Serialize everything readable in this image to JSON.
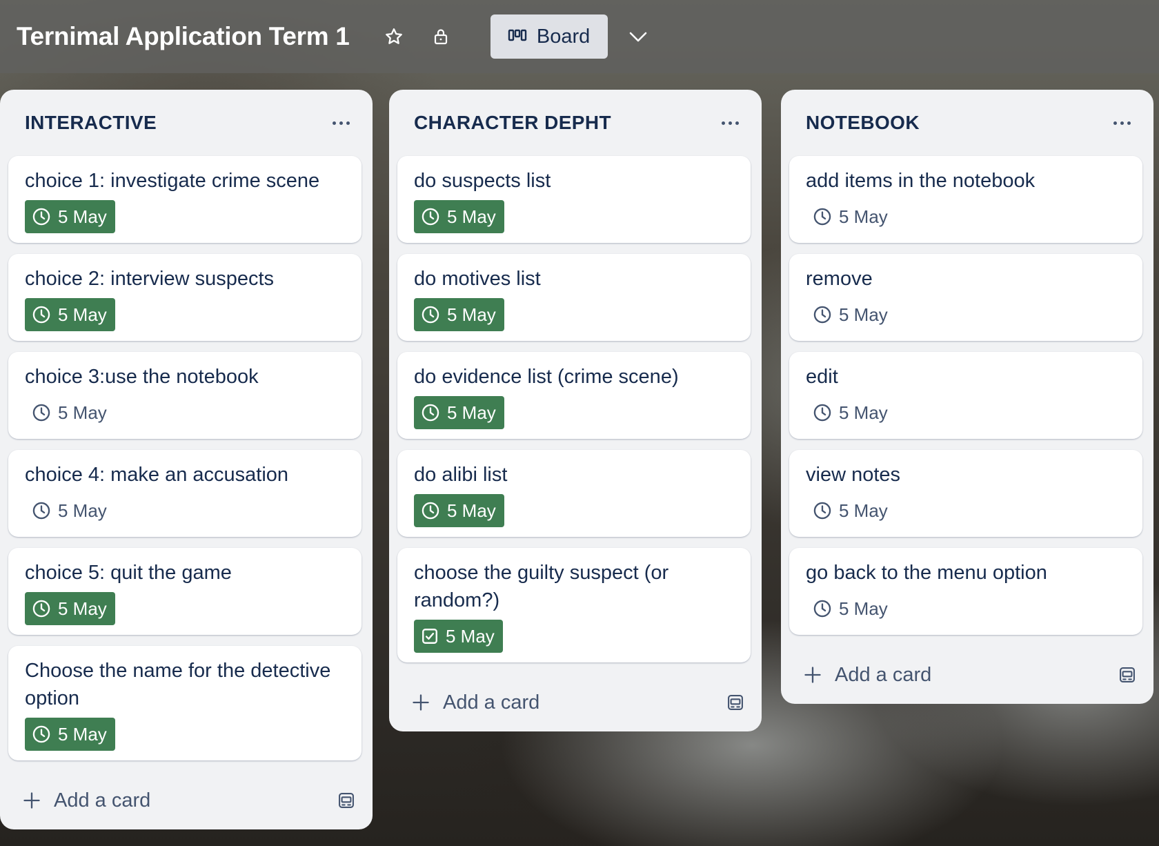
{
  "header": {
    "title": "Ternimal Application Term 1",
    "view_label": "Board",
    "icons": [
      "star-icon",
      "lock-icon",
      "board-icon",
      "chevron-down-icon"
    ]
  },
  "colors": {
    "badge_green": "#3f7e52",
    "list_bg": "#f1f2f4",
    "text": "#172b4d"
  },
  "lists": [
    {
      "title": "INTERACTIVE",
      "add_label": "Add a card",
      "cards": [
        {
          "title": "choice 1: investigate crime scene",
          "date": "5 May",
          "complete": true,
          "icon": "clock-icon"
        },
        {
          "title": "choice 2: interview suspects",
          "date": "5 May",
          "complete": true,
          "icon": "clock-icon"
        },
        {
          "title": "choice 3:use the notebook",
          "date": "5 May",
          "complete": false,
          "icon": "clock-icon"
        },
        {
          "title": "choice 4: make an accusation",
          "date": "5 May",
          "complete": false,
          "icon": "clock-icon"
        },
        {
          "title": "choice 5: quit the game",
          "date": "5 May",
          "complete": true,
          "icon": "clock-icon"
        },
        {
          "title": "Choose the name for the detective option",
          "date": "5 May",
          "complete": true,
          "icon": "clock-icon"
        }
      ]
    },
    {
      "title": "CHARACTER DEPHT",
      "add_label": "Add a card",
      "cards": [
        {
          "title": "do suspects list",
          "date": "5 May",
          "complete": true,
          "icon": "clock-icon"
        },
        {
          "title": "do motives list",
          "date": "5 May",
          "complete": true,
          "icon": "clock-icon"
        },
        {
          "title": "do evidence list (crime scene)",
          "date": "5 May",
          "complete": true,
          "icon": "clock-icon"
        },
        {
          "title": "do alibi list",
          "date": "5 May",
          "complete": true,
          "icon": "clock-icon"
        },
        {
          "title": "choose the guilty suspect (or random?)",
          "date": "5 May",
          "complete": true,
          "icon": "checkbox-icon"
        }
      ]
    },
    {
      "title": "NOTEBOOK",
      "add_label": "Add a card",
      "cards": [
        {
          "title": "add items in the notebook",
          "date": "5 May",
          "complete": false,
          "icon": "clock-icon"
        },
        {
          "title": "remove",
          "date": "5 May",
          "complete": false,
          "icon": "clock-icon"
        },
        {
          "title": "edit",
          "date": "5 May",
          "complete": false,
          "icon": "clock-icon"
        },
        {
          "title": "view notes",
          "date": "5 May",
          "complete": false,
          "icon": "clock-icon"
        },
        {
          "title": "go back to the menu option",
          "date": "5 May",
          "complete": false,
          "icon": "clock-icon"
        }
      ]
    }
  ]
}
